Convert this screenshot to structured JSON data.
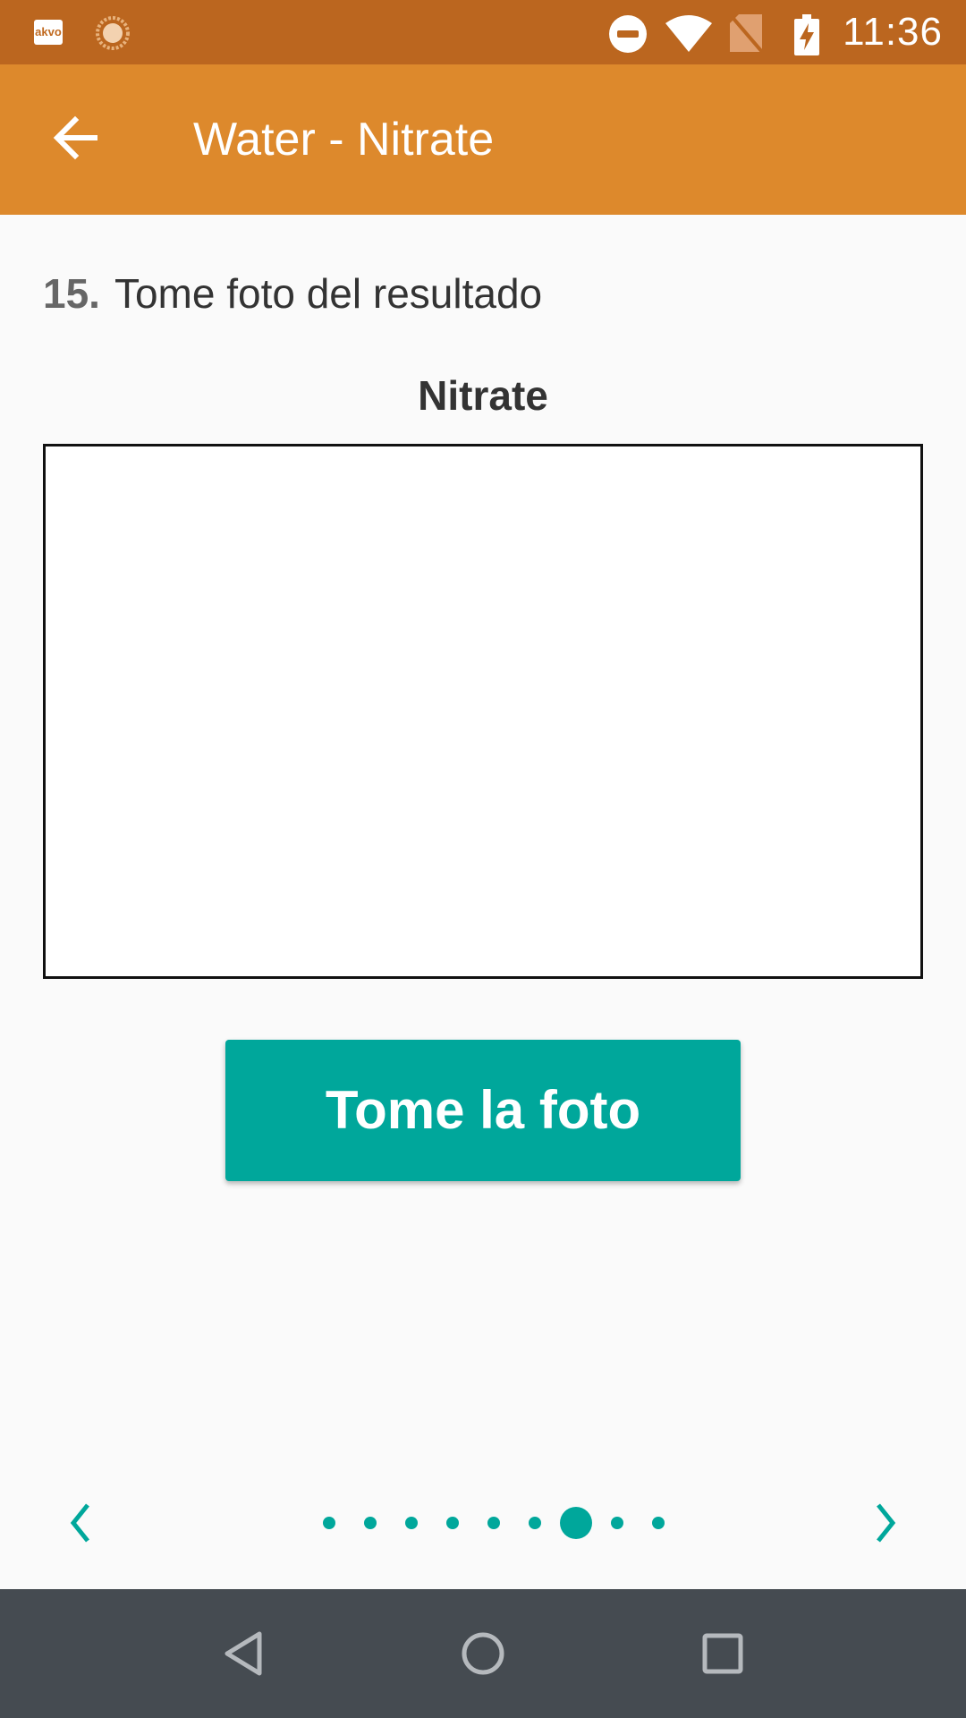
{
  "status_bar": {
    "app_badge": "akvo",
    "time": "11:36",
    "icons": [
      "akvo-icon",
      "sun-icon",
      "do-not-disturb-icon",
      "wifi-icon",
      "no-sim-icon",
      "battery-charging-icon"
    ]
  },
  "app_bar": {
    "title": "Water - Nitrate",
    "back_icon": "arrow-left-icon"
  },
  "instruction": {
    "number": "15.",
    "text": "Tome foto del resultado"
  },
  "photo": {
    "label": "Nitrate"
  },
  "button": {
    "label": "Tome la foto"
  },
  "pager": {
    "total": 9,
    "current_index": 6,
    "prev_icon": "chevron-left-icon",
    "next_icon": "chevron-right-icon"
  },
  "nav_bar": {
    "icons": [
      "back-triangle-icon",
      "home-circle-icon",
      "recents-square-icon"
    ]
  },
  "colors": {
    "status_bar": "#bb661f",
    "app_bar": "#dd892c",
    "accent": "#00a79b",
    "nav_bar": "#454b51"
  }
}
